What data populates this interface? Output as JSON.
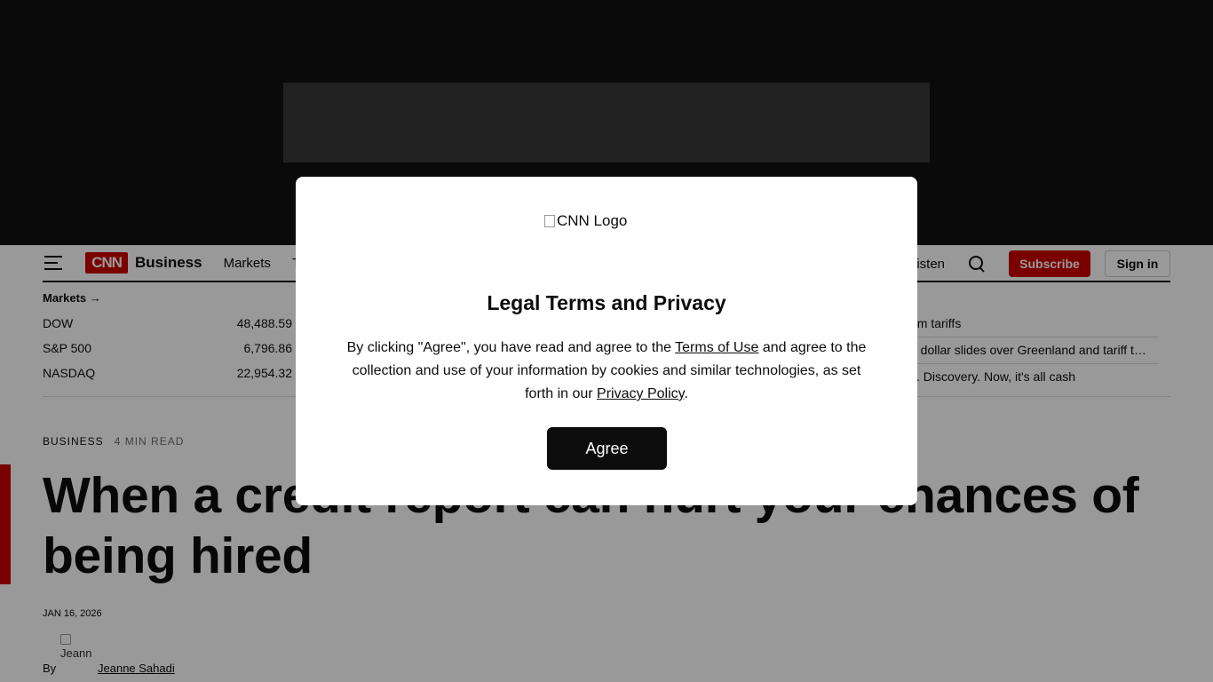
{
  "header": {
    "brand": "Business",
    "nav": [
      "Markets",
      "T"
    ],
    "listen": "isten",
    "subscribe_label": "Subscribe",
    "signin_label": "Sign in",
    "logo_text": "CNN"
  },
  "markets": {
    "link_label": "Markets →",
    "rows": [
      {
        "name": "DOW",
        "value": "48,488.59"
      },
      {
        "name": "S&P 500",
        "value": "6,796.86"
      },
      {
        "name": "NASDAQ",
        "value": "22,954.32"
      }
    ]
  },
  "headlines": [
    "om tariffs",
    "d dollar slides over Greenland and tariff t…",
    "s. Discovery. Now, it's all cash"
  ],
  "article": {
    "section": "Business",
    "read_time": "4 min read",
    "title": "When a credit report can hurt your chances of being hired",
    "date": "Jan 16, 2026",
    "by": "By",
    "avatar_alt": "Jeann",
    "author": "Jeanne Sahadi"
  },
  "modal": {
    "logo_alt": "CNN Logo",
    "title": "Legal Terms and Privacy",
    "body_1": "By clicking \"Agree\", you have read and agree to the ",
    "terms_link": "Terms of Use",
    "body_2": " and agree to the collection and use of your information by cookies and similar technologies, as set forth in our ",
    "privacy_link": "Privacy Policy",
    "body_3": ".",
    "agree_label": "Agree"
  }
}
